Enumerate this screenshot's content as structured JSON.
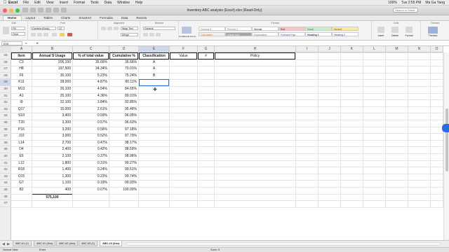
{
  "menubar": {
    "app": "Excel",
    "items": [
      "File",
      "Edit",
      "View",
      "Insert",
      "Format",
      "Tools",
      "Data",
      "Window",
      "Help"
    ],
    "battery": "100%",
    "clock": "Tue 2:55 PM",
    "user": "Ma Ga Yang"
  },
  "window": {
    "title": "Inventory ABC analysis (Excel).xlsx  (Read-Only)",
    "search_placeholder": "Search in Sheet"
  },
  "ribbon": {
    "tabs": [
      "Home",
      "Layout",
      "Tables",
      "Charts",
      "SmartArt",
      "Formulas",
      "Data",
      "Review"
    ],
    "active_tab": "Home",
    "groups": [
      "Edit",
      "Font",
      "Alignment",
      "Number",
      "Format",
      "Cells",
      "Themes"
    ],
    "font_name": "Cambria (Body)",
    "font_size": "12",
    "wrap_text": "Wrap Text",
    "number_format": "General",
    "merge": "Merge",
    "fill": "Fill",
    "clear": "Clear",
    "styles": [
      "Normal",
      "Bad",
      "Good",
      "Neutral",
      "Calculation",
      "Check Cell",
      "Explanatory",
      "Heading 1"
    ],
    "styles_row1": [
      "Comma 2",
      "Percent 2",
      "Normal",
      "Bad",
      "Good",
      "Neutral"
    ],
    "styles_row2": [
      "Calculation",
      "Check Cell",
      "Explanatory",
      "Followed Hyp...",
      "Heading 1",
      "Heading 2"
    ],
    "cond_format": "Conditional Formatting",
    "cells": [
      "Insert",
      "Delete",
      "Format"
    ],
    "themes": [
      "Themes"
    ]
  },
  "formula_bar": {
    "name_box": "E29",
    "fx": "fx",
    "value": "B"
  },
  "columns": [
    "A",
    "B",
    "C",
    "D",
    "E",
    "F",
    "G",
    "H",
    "I",
    "J",
    "K",
    "L",
    "M",
    "N",
    "O"
  ],
  "selected_column": "E",
  "rows_start": 25,
  "rows_end": 47,
  "selected_row": 29,
  "table": {
    "headers": {
      "item": "Item",
      "usage": "Annual $ Usage",
      "pct": "% of total value",
      "cum": "Cumulative %",
      "cls": "Classification",
      "value": "Value",
      "hash": "#",
      "policy": "Policy"
    },
    "rows": [
      {
        "item": "C3",
        "usage": "205,100",
        "pct": "35.66%",
        "cum": "35.66%",
        "cls": "A"
      },
      {
        "item": "H8",
        "usage": "197,500",
        "pct": "34.34%",
        "cum": "70.01%",
        "cls": "A"
      },
      {
        "item": "F6",
        "usage": "30,100",
        "pct": "5.23%",
        "cum": "75.24%",
        "cls": "B"
      },
      {
        "item": "K11",
        "usage": "28,000",
        "pct": "4.87%",
        "cum": "80.11%",
        "cls": ""
      },
      {
        "item": "M13",
        "usage": "26,100",
        "pct": "4.54%",
        "cum": "84.65%",
        "cls": ""
      },
      {
        "item": "A1",
        "usage": "25,100",
        "pct": "4.36%",
        "cum": "89.01%",
        "cls": ""
      },
      {
        "item": "I9",
        "usage": "22,100",
        "pct": "3.84%",
        "cum": "92.85%",
        "cls": ""
      },
      {
        "item": "Q17",
        "usage": "15,000",
        "pct": "2.61%",
        "cum": "95.46%",
        "cls": ""
      },
      {
        "item": "S19",
        "usage": "3,400",
        "pct": "0.59%",
        "cum": "96.05%",
        "cls": ""
      },
      {
        "item": "T20",
        "usage": "3,300",
        "pct": "0.57%",
        "cum": "96.63%",
        "cls": ""
      },
      {
        "item": "P16",
        "usage": "3,200",
        "pct": "0.56%",
        "cum": "97.18%",
        "cls": ""
      },
      {
        "item": "J10",
        "usage": "3,000",
        "pct": "0.52%",
        "cum": "97.70%",
        "cls": ""
      },
      {
        "item": "L14",
        "usage": "2,700",
        "pct": "0.47%",
        "cum": "98.17%",
        "cls": ""
      },
      {
        "item": "D4",
        "usage": "2,400",
        "pct": "0.42%",
        "cum": "98.59%",
        "cls": ""
      },
      {
        "item": "E5",
        "usage": "2,100",
        "pct": "0.37%",
        "cum": "98.96%",
        "cls": ""
      },
      {
        "item": "L12",
        "usage": "1,800",
        "pct": "0.31%",
        "cum": "99.27%",
        "cls": ""
      },
      {
        "item": "R18",
        "usage": "1,400",
        "pct": "0.24%",
        "cum": "99.51%",
        "cls": ""
      },
      {
        "item": "O15",
        "usage": "1,300",
        "pct": "0.23%",
        "cum": "99.74%",
        "cls": ""
      },
      {
        "item": "G7",
        "usage": "1,100",
        "pct": "0.19%",
        "cum": "99.93%",
        "cls": ""
      },
      {
        "item": "B2",
        "usage": "400",
        "pct": "0.07%",
        "cum": "100.00%",
        "cls": ""
      }
    ],
    "total": "575,100"
  },
  "sheet_tabs": [
    "ABC-#1 (1)",
    "ABC-#1 (Ans)",
    "ABC-#2 (Ans)",
    "ABC-#3 (1)",
    "ABC-#3 (Ans)"
  ],
  "active_sheet": "ABC-#3 (Ans)",
  "status": {
    "view": "Normal View",
    "mode": "Enter",
    "sum": "Sum= 0"
  }
}
